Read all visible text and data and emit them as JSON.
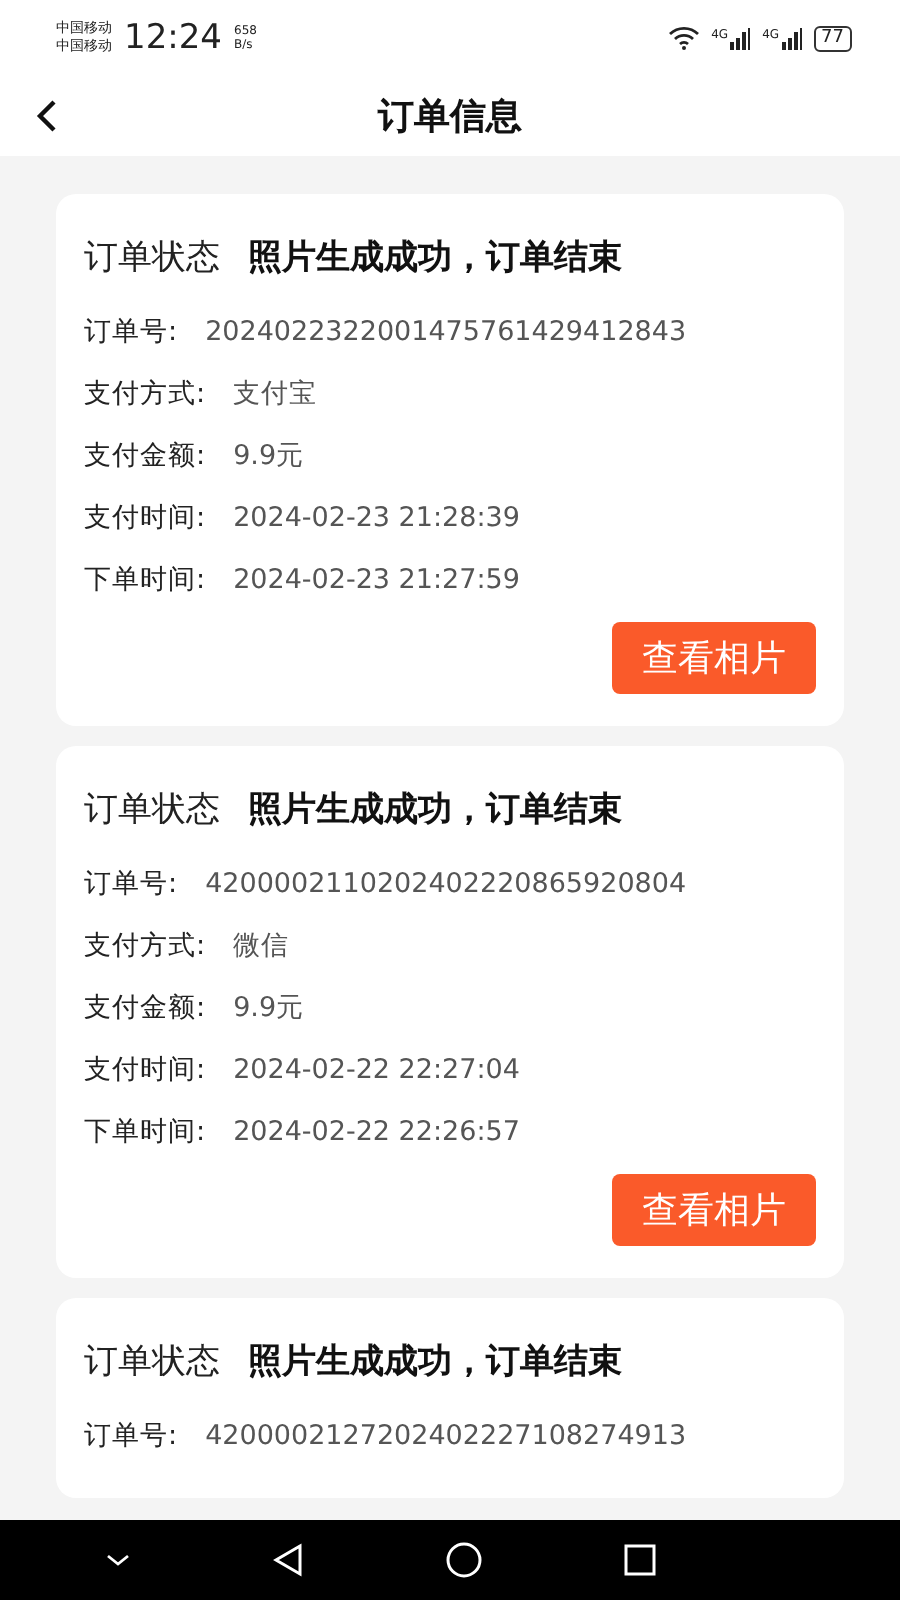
{
  "status_bar": {
    "carriers": [
      "中国移动",
      "中国移动"
    ],
    "time": "12:24",
    "speed": "658",
    "speed_unit": "B/s",
    "networks": [
      "4G",
      "4G"
    ],
    "battery": "77"
  },
  "header": {
    "title": "订单信息"
  },
  "orders": [
    {
      "status_label": "订单状态",
      "status": "照片生成成功，订单结束",
      "fields": [
        {
          "label": "订单号:",
          "value": "2024022322001475761429412843"
        },
        {
          "label": "支付方式:",
          "value": "支付宝"
        },
        {
          "label": "支付金额:",
          "value": "9.9元"
        },
        {
          "label": "支付时间:",
          "value": "2024-02-23 21:28:39"
        },
        {
          "label": "下单时间:",
          "value": "2024-02-23 21:27:59"
        }
      ],
      "button": "查看相片"
    },
    {
      "status_label": "订单状态",
      "status": "照片生成成功，订单结束",
      "fields": [
        {
          "label": "订单号:",
          "value": "4200002110202402220865920804"
        },
        {
          "label": "支付方式:",
          "value": "微信"
        },
        {
          "label": "支付金额:",
          "value": "9.9元"
        },
        {
          "label": "支付时间:",
          "value": "2024-02-22 22:27:04"
        },
        {
          "label": "下单时间:",
          "value": "2024-02-22 22:26:57"
        }
      ],
      "button": "查看相片"
    },
    {
      "status_label": "订单状态",
      "status": "照片生成成功，订单结束",
      "fields": [
        {
          "label": "订单号:",
          "value": "4200002127202402227108274913"
        }
      ]
    }
  ]
}
